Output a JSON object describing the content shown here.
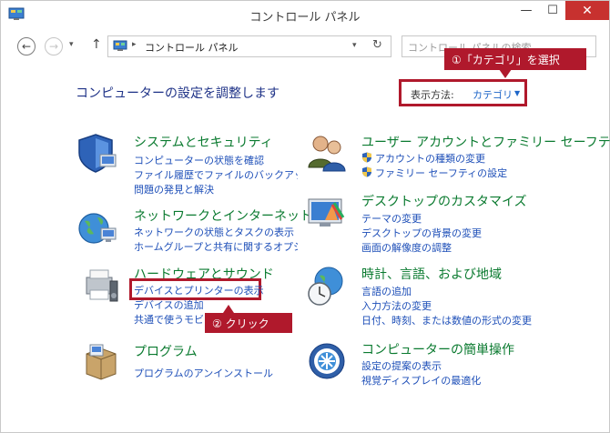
{
  "window": {
    "title": "コントロール パネル",
    "controls": {
      "minimize": "—",
      "maximize": "☐",
      "close": "✕"
    }
  },
  "nav": {
    "back": "←",
    "forward": "→",
    "dropdown": "▾",
    "up": "↑",
    "address_separator": "▸",
    "address": "コントロール パネル",
    "address_dropdown": "▾",
    "refresh": "↻",
    "search_placeholder": "コントロール パネルの検索"
  },
  "page": {
    "heading": "コンピューターの設定を調整します",
    "view_by_label": "表示方法:",
    "view_by_value": "カテゴリ",
    "view_by_caret": "▼"
  },
  "callouts": {
    "step1": "①「カテゴリ」を選択",
    "step2": "② クリック"
  },
  "categories": [
    {
      "title": "システムとセキュリティ",
      "links": [
        "コンピューターの状態を確認",
        "ファイル履歴でファイルのバックアップ コ",
        "問題の発見と解決"
      ]
    },
    {
      "title": "ネットワークとインターネット",
      "links": [
        "ネットワークの状態とタスクの表示",
        "ホームグループと共有に関するオプショ"
      ]
    },
    {
      "title": "ハードウェアとサウンド",
      "links": [
        "デバイスとプリンターの表示",
        "デバイスの追加",
        "共通で使うモビリティ"
      ]
    },
    {
      "title": "プログラム",
      "links": [
        "プログラムのアンインストール"
      ]
    },
    {
      "title": "ユーザー アカウントとファミリー セーフティ",
      "links": [
        "アカウントの種類の変更",
        "ファミリー セーフティの設定"
      ]
    },
    {
      "title": "デスクトップのカスタマイズ",
      "links": [
        "テーマの変更",
        "デスクトップの背景の変更",
        "画面の解像度の調整"
      ]
    },
    {
      "title": "時計、言語、および地域",
      "links": [
        "言語の追加",
        "入力方法の変更",
        "日付、時刻、または数値の形式の変更"
      ]
    },
    {
      "title": "コンピューターの簡単操作",
      "links": [
        "設定の提案の表示",
        "視覚ディスプレイの最適化"
      ]
    }
  ],
  "colors": {
    "accent_red": "#b0192c",
    "category_green": "#0a7a2f",
    "link_blue": "#1e4fb8",
    "heading_blue": "#1e3287"
  }
}
